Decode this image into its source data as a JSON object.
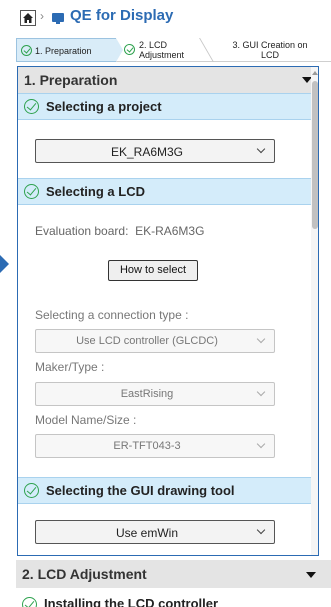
{
  "header": {
    "title": "QE for Display"
  },
  "steps": [
    {
      "label": "1. Preparation"
    },
    {
      "label_line1": "2. LCD",
      "label_line2": "Adjustment"
    },
    {
      "label_line1": "3. GUI Creation on",
      "label_line2": "LCD"
    }
  ],
  "preparation": {
    "title": "1. Preparation",
    "project": {
      "title": "Selecting a project",
      "value": "EK_RA6M3G"
    },
    "lcd": {
      "title": "Selecting a LCD",
      "board_label": "Evaluation board:",
      "board_value": "EK-RA6M3G",
      "how_button": "How to select",
      "connection_label": "Selecting a connection type :",
      "connection_value": "Use LCD controller (GLCDC)",
      "maker_label": "Maker/Type :",
      "maker_value": "EastRising",
      "model_label": "Model Name/Size :",
      "model_value": "ER-TFT043-3"
    },
    "gui_tool": {
      "title": "Selecting the GUI drawing tool",
      "value": "Use emWin"
    }
  },
  "lcd_adjustment": {
    "title": "2. LCD Adjustment",
    "first_item": "Installing the LCD controller"
  },
  "colors": {
    "accent": "#2c6bb3",
    "check": "#2fa24f",
    "section_bg": "#d4ecfa"
  }
}
